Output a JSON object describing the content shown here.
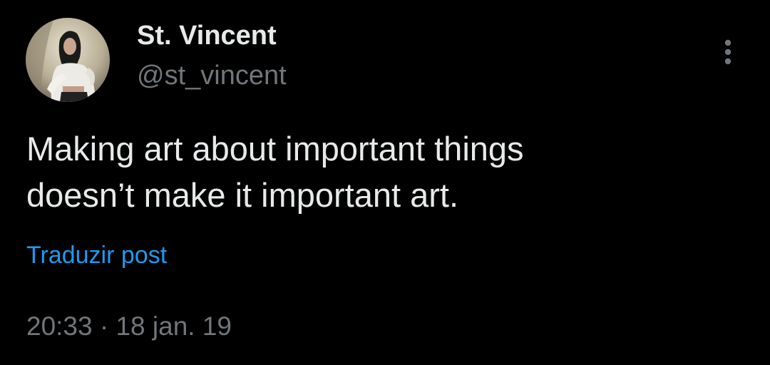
{
  "author": {
    "display_name": "St. Vincent",
    "handle": "@st_vincent",
    "avatar_icon": "profile-photo"
  },
  "post": {
    "text_lines": [
      "Making art about important things",
      "doesn’t make it important art."
    ],
    "translate_label": "Traduzir post",
    "time": "20:33",
    "separator": "·",
    "date": "18 jan. 19"
  },
  "menu": {
    "icon": "more-options-icon"
  },
  "colors": {
    "background": "#000000",
    "primary_text": "#e7e9ea",
    "secondary_text": "#71767b",
    "link": "#1d9bf0"
  }
}
